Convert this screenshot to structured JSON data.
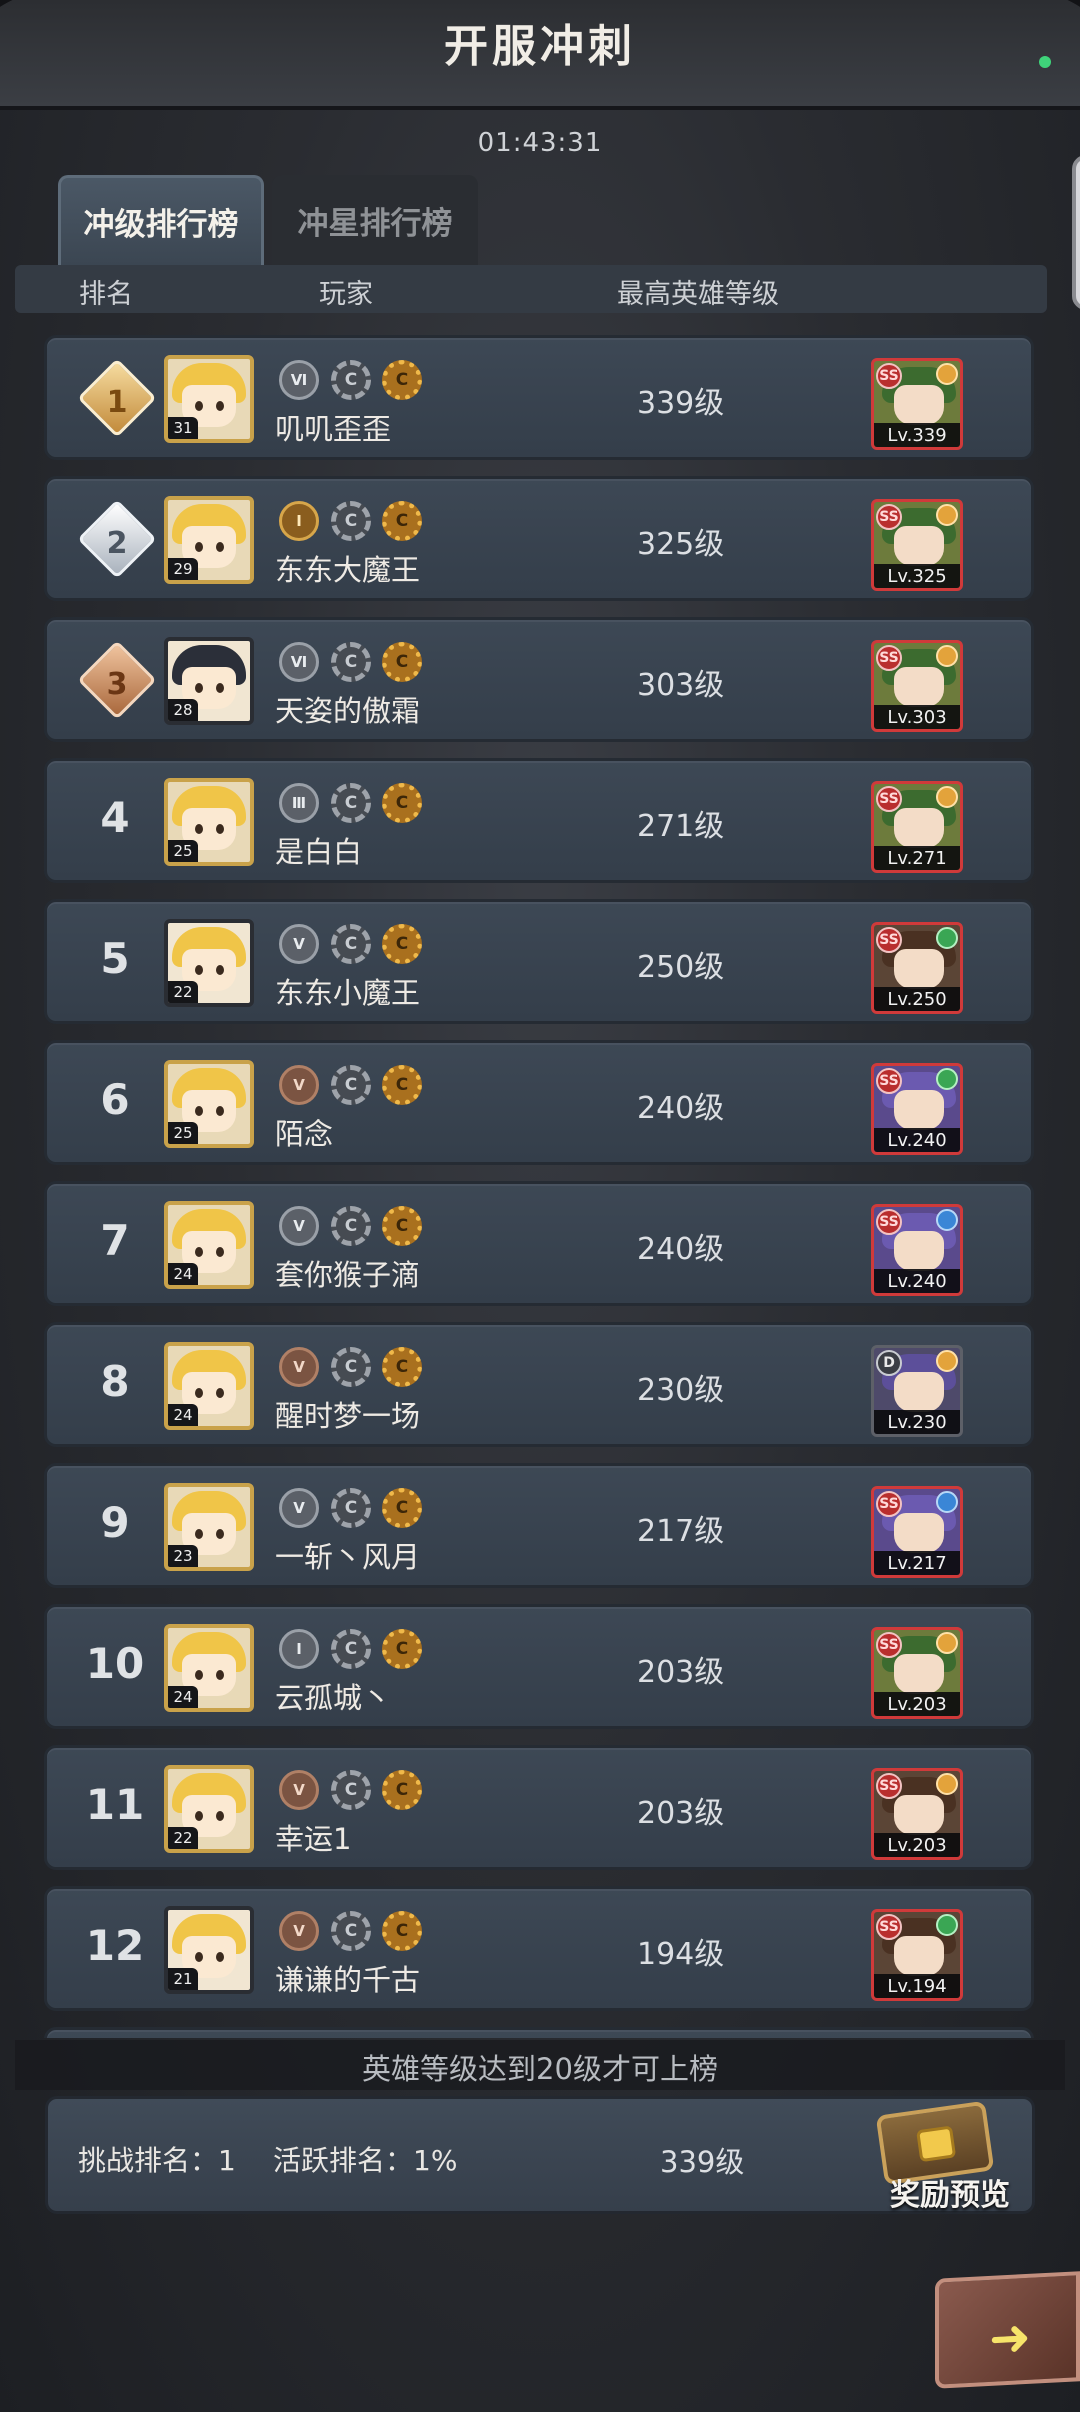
{
  "header": {
    "title": "开服冲刺",
    "countdown": "01:43:31"
  },
  "tabs": [
    {
      "label": "冲级排行榜",
      "active": true
    },
    {
      "label": "冲星排行榜",
      "active": false
    }
  ],
  "columns": {
    "rank": "排名",
    "player": "玩家",
    "hero_level": "最高英雄等级"
  },
  "rows": [
    {
      "rank": "1",
      "avatar_level": "31",
      "name": "叽叽歪歪",
      "rank_badge": "Ⅵ",
      "hero_level": "339级",
      "hero_lv": "Lv.339",
      "hero_rarity": "SS"
    },
    {
      "rank": "2",
      "avatar_level": "29",
      "name": "东东大魔王",
      "rank_badge": "Ⅰ",
      "hero_level": "325级",
      "hero_lv": "Lv.325",
      "hero_rarity": "SS"
    },
    {
      "rank": "3",
      "avatar_level": "28",
      "name": "天姿的傲霜",
      "rank_badge": "Ⅵ",
      "hero_level": "303级",
      "hero_lv": "Lv.303",
      "hero_rarity": "SS"
    },
    {
      "rank": "4",
      "avatar_level": "25",
      "name": "是白白",
      "rank_badge": "Ⅲ",
      "hero_level": "271级",
      "hero_lv": "Lv.271",
      "hero_rarity": "SS"
    },
    {
      "rank": "5",
      "avatar_level": "22",
      "name": "东东小魔王",
      "rank_badge": "Ⅴ",
      "hero_level": "250级",
      "hero_lv": "Lv.250",
      "hero_rarity": "SS"
    },
    {
      "rank": "6",
      "avatar_level": "25",
      "name": "陌念",
      "rank_badge": "Ⅴ",
      "hero_level": "240级",
      "hero_lv": "Lv.240",
      "hero_rarity": "SS"
    },
    {
      "rank": "7",
      "avatar_level": "24",
      "name": "套你猴子滴",
      "rank_badge": "Ⅴ",
      "hero_level": "240级",
      "hero_lv": "Lv.240",
      "hero_rarity": "SS"
    },
    {
      "rank": "8",
      "avatar_level": "24",
      "name": "醒时梦一场",
      "rank_badge": "Ⅴ",
      "hero_level": "230级",
      "hero_lv": "Lv.230",
      "hero_rarity": "D"
    },
    {
      "rank": "9",
      "avatar_level": "23",
      "name": "一斩丶风月",
      "rank_badge": "Ⅴ",
      "hero_level": "217级",
      "hero_lv": "Lv.217",
      "hero_rarity": "SS"
    },
    {
      "rank": "10",
      "avatar_level": "24",
      "name": "云孤城丶",
      "rank_badge": "Ⅰ",
      "hero_level": "203级",
      "hero_lv": "Lv.203",
      "hero_rarity": "SS"
    },
    {
      "rank": "11",
      "avatar_level": "22",
      "name": "幸运1",
      "rank_badge": "Ⅴ",
      "hero_level": "203级",
      "hero_lv": "Lv.203",
      "hero_rarity": "SS"
    },
    {
      "rank": "12",
      "avatar_level": "21",
      "name": "谦谦的千古",
      "rank_badge": "Ⅴ",
      "hero_level": "194级",
      "hero_lv": "Lv.194",
      "hero_rarity": "SS"
    }
  ],
  "footer": {
    "notice": "英雄等级达到20级才可上榜",
    "challenge_rank": "挑战排名：1",
    "active_rank": "活跃排名：1%",
    "my_level": "339级",
    "reward_label": "奖励预览"
  },
  "icons": {
    "next": "arrow-right-icon",
    "chest": "treasure-chest-icon"
  },
  "colors": {
    "row_bg": "#3d4855",
    "accent_gold": "#c9a24a",
    "hero_frame_red": "#d03a3a"
  }
}
